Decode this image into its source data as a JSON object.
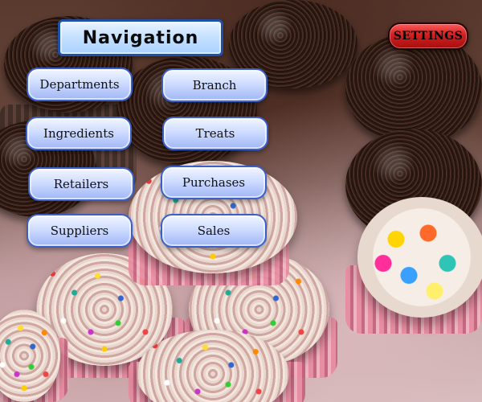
{
  "header": {
    "title": "Navigation"
  },
  "settings": {
    "label": "SETTINGS"
  },
  "navigation": {
    "buttons": [
      {
        "label": "Departments"
      },
      {
        "label": "Branch"
      },
      {
        "label": "Ingredients"
      },
      {
        "label": "Treats"
      },
      {
        "label": "Retailers"
      },
      {
        "label": "Purchases"
      },
      {
        "label": "Suppliers"
      },
      {
        "label": "Sales"
      }
    ]
  },
  "colors": {
    "title_border": "#1e50a8",
    "nav_button_border": "#3b5fc9",
    "settings_fill": "#d01f1f"
  }
}
